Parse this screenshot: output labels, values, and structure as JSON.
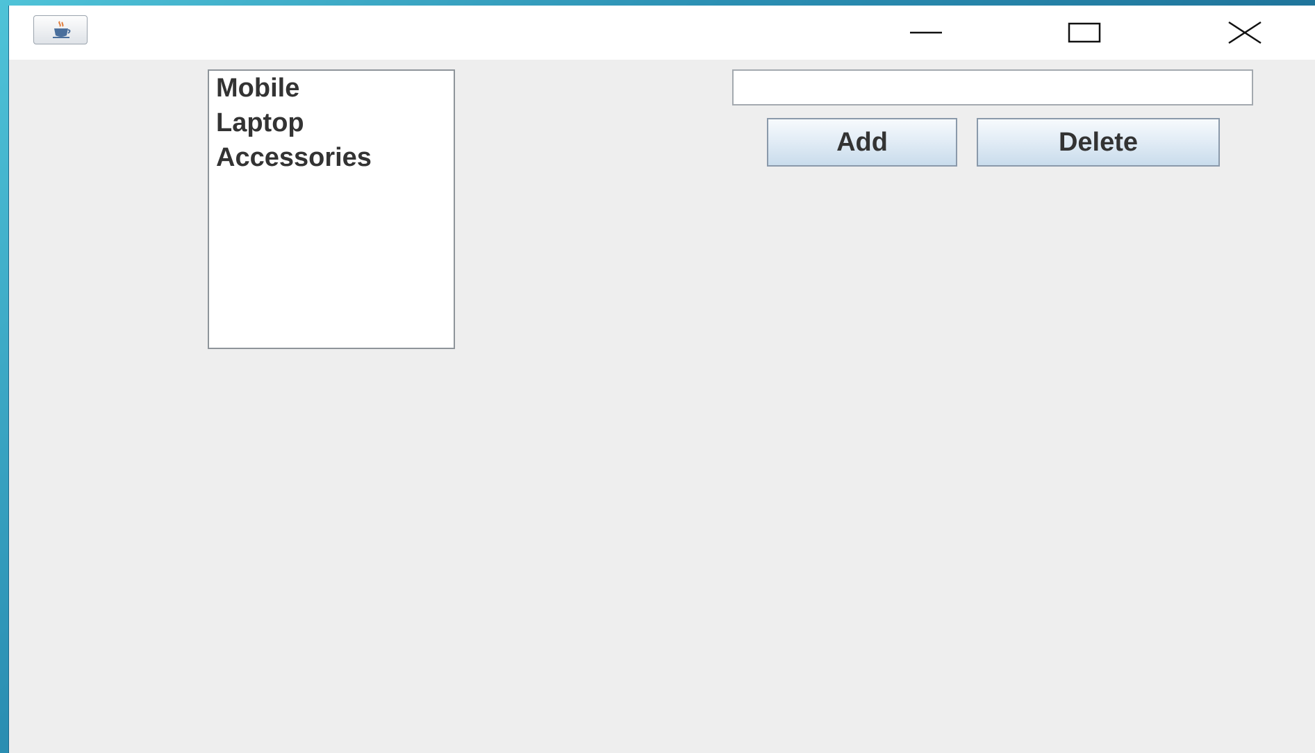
{
  "window": {
    "controls": {
      "minimize_icon": "minimize-icon",
      "maximize_icon": "maximize-icon",
      "close_icon": "close-icon"
    },
    "app_icon": "java-cup-icon"
  },
  "list": {
    "items": [
      "Mobile",
      "Laptop",
      "Accessories"
    ]
  },
  "input": {
    "value": "",
    "placeholder": ""
  },
  "buttons": {
    "add_label": "Add",
    "delete_label": "Delete"
  },
  "colors": {
    "window_background": "#eeeeee",
    "titlebar_background": "#ffffff",
    "desktop_accent": "#2b8fb3"
  }
}
